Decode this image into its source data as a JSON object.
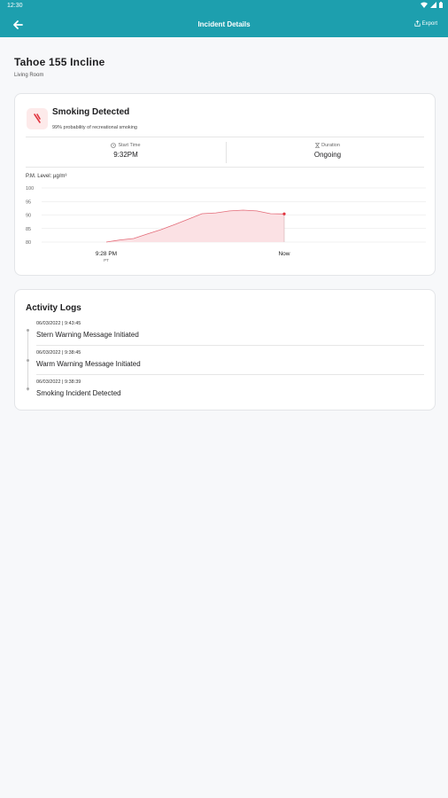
{
  "status_bar": {
    "time": "12:30"
  },
  "app_bar": {
    "title": "Incident Details",
    "export_label": "Export"
  },
  "location": {
    "name": "Tahoe 155 Incline",
    "room": "Living Room"
  },
  "incident": {
    "title": "Smoking Detected",
    "description": "99% probability of recreational smoking",
    "start_time_label": "Start Time",
    "start_time_value": "9:32PM",
    "duration_label": "Duration",
    "duration_value": "Ongoing",
    "pm_label": "P.M. Level: µg/m³",
    "accent_color": "#e1343f"
  },
  "chart_data": {
    "type": "area",
    "ylabel": "P.M. Level: µg/m³",
    "ylim": [
      80,
      100
    ],
    "yticks": [
      100,
      95,
      90,
      85,
      80
    ],
    "x_tick_labels": [
      {
        "label": "9:28 PM",
        "sub": "PT"
      },
      {
        "label": "Now",
        "sub": ""
      }
    ],
    "series": [
      {
        "values": [
          80,
          80.8,
          81.3,
          83.0,
          84.6,
          86.5,
          88.5,
          90.5,
          90.8,
          91.5,
          91.8,
          91.5,
          90.5,
          90.4
        ]
      }
    ],
    "color": "#e36b78",
    "fill_color": "#fbe1e4"
  },
  "activity": {
    "title": "Activity Logs",
    "logs": [
      {
        "date": "06/03/2022 | 9:43:45",
        "text": "Stern Warning Message Initiated"
      },
      {
        "date": "06/03/2022 | 9:38:45",
        "text": "Warm Warning Message Initiated"
      },
      {
        "date": "06/03/2022 | 9:38:39",
        "text": "Smoking Incident Detected"
      }
    ]
  }
}
